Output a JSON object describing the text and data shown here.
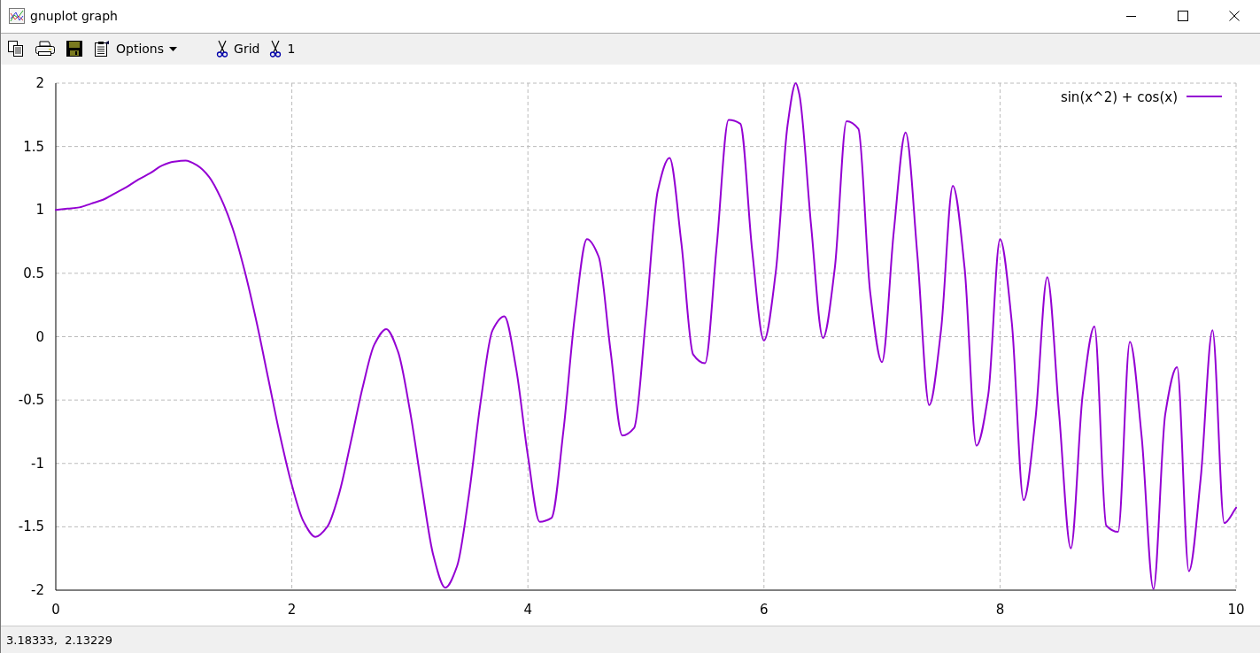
{
  "window": {
    "title": "gnuplot graph"
  },
  "toolbar": [
    {
      "kind": "copy"
    },
    {
      "kind": "print"
    },
    {
      "kind": "save"
    },
    {
      "kind": "options",
      "label": "Options"
    },
    {
      "kind": "scissors",
      "label": "Grid"
    },
    {
      "kind": "scissors",
      "label": "1"
    }
  ],
  "plot": {
    "chart_data": {
      "type": "line",
      "x": [
        0,
        0.1,
        0.2,
        0.3,
        0.4,
        0.5,
        0.6,
        0.7,
        0.8,
        0.9,
        1,
        1.1,
        1.2,
        1.3,
        1.4,
        1.5,
        1.6,
        1.7,
        1.8,
        1.9,
        2,
        2.1,
        2.2,
        2.3,
        2.4,
        2.5,
        2.6,
        2.7,
        2.8,
        2.9,
        3,
        3.1,
        3.2,
        3.3,
        3.4,
        3.5,
        3.6,
        3.7,
        3.8,
        3.9,
        4,
        4.1,
        4.2,
        4.3,
        4.4,
        4.5,
        4.6,
        4.7,
        4.8,
        4.9,
        5,
        5.1,
        5.2,
        5.3,
        5.4,
        5.5,
        5.6,
        5.7,
        5.8,
        5.9,
        6,
        6.1,
        6.2,
        6.27,
        6.3,
        6.4,
        6.5,
        6.6,
        6.7,
        6.8,
        6.9,
        7,
        7.1,
        7.2,
        7.3,
        7.4,
        7.5,
        7.6,
        7.7,
        7.8,
        7.9,
        8,
        8.1,
        8.2,
        8.3,
        8.4,
        8.5,
        8.6,
        8.7,
        8.8,
        8.9,
        9,
        9.1,
        9.2,
        9.3,
        9.4,
        9.5,
        9.6,
        9.7,
        9.8,
        9.9,
        10
      ],
      "series": [
        {
          "name": "sin(x^2) + cos(x)",
          "color": "#9400d3",
          "values": [
            1,
            1.01,
            1.02,
            1.05,
            1.08,
            1.13,
            1.18,
            1.24,
            1.29,
            1.35,
            1.38,
            1.39,
            1.35,
            1.26,
            1.09,
            0.85,
            0.52,
            0.12,
            -0.33,
            -0.78,
            -1.17,
            -1.46,
            -1.58,
            -1.5,
            -1.24,
            -0.83,
            -0.4,
            -0.06,
            0.06,
            -0.12,
            -0.58,
            -1.18,
            -1.73,
            -1.98,
            -1.81,
            -1.25,
            -0.51,
            0.05,
            0.16,
            -0.25,
            -0.94,
            -1.46,
            -1.43,
            -0.75,
            0.18,
            0.77,
            0.63,
            -0.11,
            -0.78,
            -0.72,
            0.15,
            1.15,
            1.41,
            0.74,
            -0.14,
            -0.21,
            0.72,
            1.71,
            1.68,
            0.68,
            -0.03,
            0.51,
            1.67,
            2,
            1.91,
            0.87,
            -0.01,
            0.54,
            1.7,
            1.64,
            0.35,
            -0.2,
            0.83,
            1.61,
            0.64,
            -0.54,
            0.05,
            1.19,
            0.54,
            -0.86,
            -0.46,
            0.77,
            0.11,
            -1.29,
            -0.65,
            0.47,
            -0.6,
            -1.67,
            -0.46,
            0.08,
            -1.49,
            -1.54,
            -0.04,
            -0.79,
            -1.99,
            -0.61,
            -0.24,
            -1.85,
            -1.12,
            0.05,
            -1.47,
            -1.35
          ]
        }
      ],
      "grid": true,
      "xlim": [
        0,
        10
      ],
      "ylim": [
        -2,
        2
      ],
      "xticks": [
        0,
        2,
        4,
        6,
        8,
        10
      ],
      "yticks": [
        -2,
        {
          "value": -1.5,
          "label": "-1.5"
        },
        -1,
        {
          "value": -0.5,
          "label": "-0.5"
        },
        0,
        {
          "value": 0.5,
          "label": "0.5"
        },
        1,
        {
          "value": 1.5,
          "label": "1.5"
        },
        2
      ]
    }
  },
  "status_bar": "3.18333,  2.13229"
}
